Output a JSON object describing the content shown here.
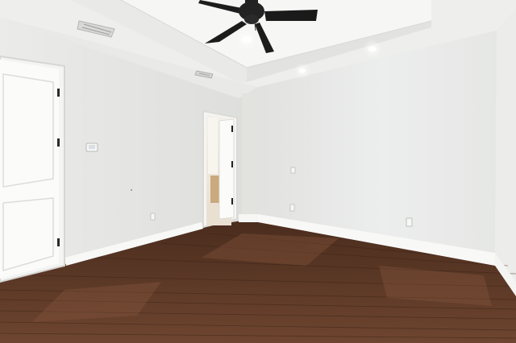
{
  "scene": {
    "kind": "empty bedroom interior photo",
    "colors": {
      "wall_left": "#e4e5e2",
      "wall_back": "#e6e7e5",
      "wall_right": "#ebebea",
      "ceiling": "#f1f1f0",
      "tray_ceiling": "#f5f5f4",
      "trim": "#f7f7f6",
      "floor_dark": "#3f2417",
      "floor_mid": "#5b3826",
      "floor_light": "#7a4e35",
      "fan_black": "#1a1a1a",
      "door_white": "#fbfbfa"
    },
    "objects": [
      "ceiling-fan-icon",
      "recessed-light-icon",
      "air-vent-icon",
      "thermostat-icon",
      "electrical-outlet-icon",
      "light-switch-icon",
      "panel-door",
      "open-doorway",
      "baseboard",
      "hardwood-floor"
    ]
  }
}
